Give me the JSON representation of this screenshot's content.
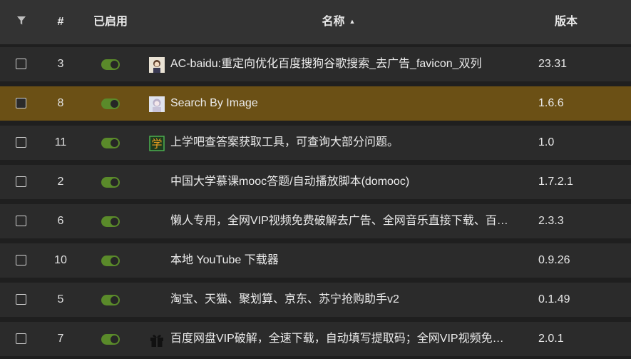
{
  "header": {
    "num_label": "#",
    "enabled_label": "已启用",
    "name_label": "名称",
    "sort_indicator": "▲",
    "version_label": "版本",
    "filter_icon": "filter-icon"
  },
  "colors": {
    "toggle_on": "#5a8a2a",
    "selected_row": "#6b5015",
    "row_bg": "#2b2b2b",
    "header_bg": "#333333"
  },
  "rows": [
    {
      "num": "3",
      "name": "AC-baidu:重定向优化百度搜狗谷歌搜索_去广告_favicon_双列",
      "version": "23.31",
      "icon": "ac-baidu-avatar-icon",
      "enabled": true,
      "selected": false
    },
    {
      "num": "8",
      "name": "Search By Image",
      "version": "1.6.6",
      "icon": "search-by-image-avatar-icon",
      "enabled": true,
      "selected": true
    },
    {
      "num": "11",
      "name": "上学吧查答案获取工具，可查询大部分问题。",
      "version": "1.0",
      "icon": "xue-icon",
      "enabled": true,
      "selected": false
    },
    {
      "num": "2",
      "name": "中国大学慕课mooc答题/自动播放脚本(domooc)",
      "version": "1.7.2.1",
      "icon": "",
      "enabled": true,
      "selected": false
    },
    {
      "num": "6",
      "name": "懒人专用，全网VIP视频免费破解去广告、全网音乐直接下载、百…",
      "version": "2.3.3",
      "icon": "",
      "enabled": true,
      "selected": false
    },
    {
      "num": "10",
      "name": "本地 YouTube 下载器",
      "version": "0.9.26",
      "icon": "",
      "enabled": true,
      "selected": false
    },
    {
      "num": "5",
      "name": "淘宝、天猫、聚划算、京东、苏宁抢购助手v2",
      "version": "0.1.49",
      "icon": "",
      "enabled": true,
      "selected": false
    },
    {
      "num": "7",
      "name": "百度网盘VIP破解，全速下载，自动填写提取码；全网VIP视频免…",
      "version": "2.0.1",
      "icon": "gift-icon",
      "enabled": true,
      "selected": false
    }
  ]
}
